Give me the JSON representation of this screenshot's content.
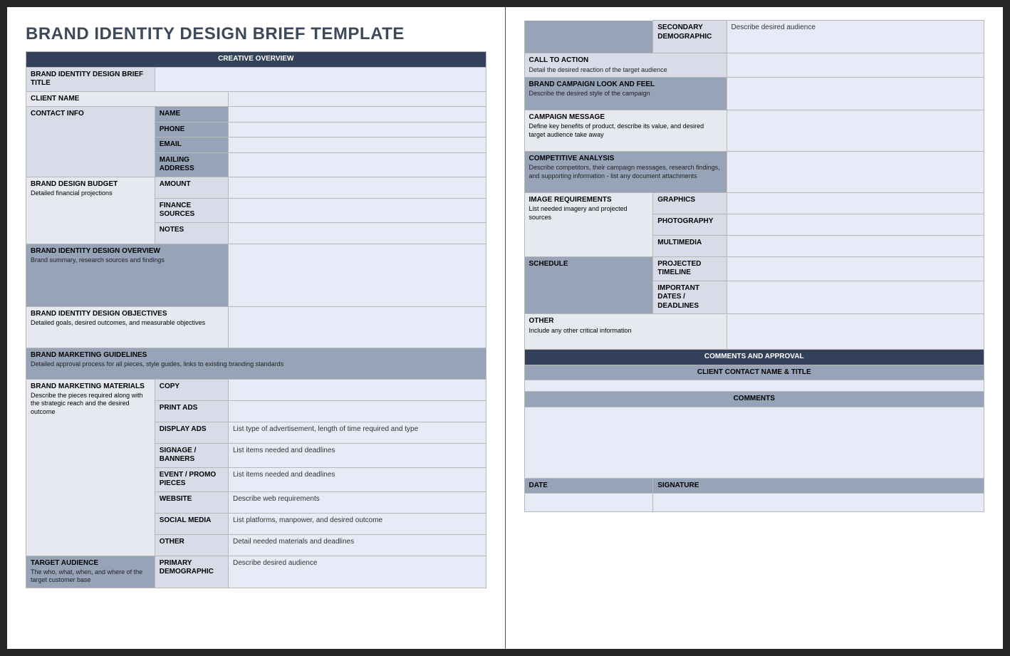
{
  "title": "BRAND IDENTITY DESIGN BRIEF TEMPLATE",
  "sections": {
    "creative_overview": "CREATIVE OVERVIEW",
    "comments_approval": "COMMENTS AND APPROVAL",
    "client_contact_hdr": "CLIENT CONTACT NAME & TITLE",
    "comments_hdr": "COMMENTS"
  },
  "rows": {
    "brief_title": "BRAND IDENTITY DESIGN BRIEF TITLE",
    "client_name": "CLIENT NAME",
    "contact_info": "CONTACT INFO",
    "name": "NAME",
    "phone": "PHONE",
    "email": "EMAIL",
    "mailing_address": "MAILING ADDRESS",
    "budget": "BRAND DESIGN BUDGET",
    "budget_sub": "Detailed financial projections",
    "amount": "AMOUNT",
    "finance_sources": "FINANCE SOURCES",
    "notes": "NOTES",
    "overview": "BRAND IDENTITY DESIGN OVERVIEW",
    "overview_sub": "Brand summary, research sources and findings",
    "objectives": "BRAND IDENTITY DESIGN OBJECTIVES",
    "objectives_sub": "Detailed goals, desired outcomes, and measurable objectives",
    "guidelines": "BRAND MARKETING GUIDELINES",
    "guidelines_sub": "Detailed approval process for all pieces, style guides, links to existing branding standards",
    "materials": "BRAND MARKETING MATERIALS",
    "materials_sub": "Describe the pieces required along with the strategic reach and the desired outcome",
    "copy": "COPY",
    "print_ads": "PRINT ADS",
    "display_ads": "DISPLAY ADS",
    "display_ads_hint": "List type of advertisement, length of time required and type",
    "signage": "SIGNAGE / BANNERS",
    "signage_hint": "List items needed and deadlines",
    "event_promo": "EVENT / PROMO PIECES",
    "event_promo_hint": "List items needed and deadlines",
    "website": "WEBSITE",
    "website_hint": "Describe web requirements",
    "social": "SOCIAL MEDIA",
    "social_hint": "List platforms, manpower, and desired outcome",
    "other_mat": "OTHER",
    "other_mat_hint": "Detail needed materials and deadlines",
    "target": "TARGET AUDIENCE",
    "target_sub": "The who, what, when, and where of the target customer base",
    "primary_demo": "PRIMARY DEMOGRAPHIC",
    "primary_demo_hint": "Describe desired audience",
    "secondary_demo": "SECONDARY DEMOGRAPHIC",
    "secondary_demo_hint": "Describe desired audience",
    "cta": "CALL TO ACTION",
    "cta_sub": "Detail the desired reaction of the target audience",
    "look_feel": "BRAND CAMPAIGN LOOK AND FEEL",
    "look_feel_sub": "Describe the desired style of the campaign",
    "campaign_msg": "CAMPAIGN MESSAGE",
    "campaign_msg_sub": "Define key benefits of product, describe its value, and desired target audience take away",
    "competitive": "COMPETITIVE ANALYSIS",
    "competitive_sub": "Describe competitors, their campaign messages, research findings, and supporting information - list any document attachments",
    "image_req": "IMAGE REQUIREMENTS",
    "image_req_sub": "List needed imagery and projected sources",
    "graphics": "GRAPHICS",
    "photography": "PHOTOGRAPHY",
    "multimedia": "MULTIMEDIA",
    "schedule": "SCHEDULE",
    "timeline": "PROJECTED TIMELINE",
    "deadlines": "IMPORTANT DATES / DEADLINES",
    "other": "OTHER",
    "other_sub": "Include any other critical information",
    "date": "DATE",
    "signature": "SIGNATURE"
  }
}
